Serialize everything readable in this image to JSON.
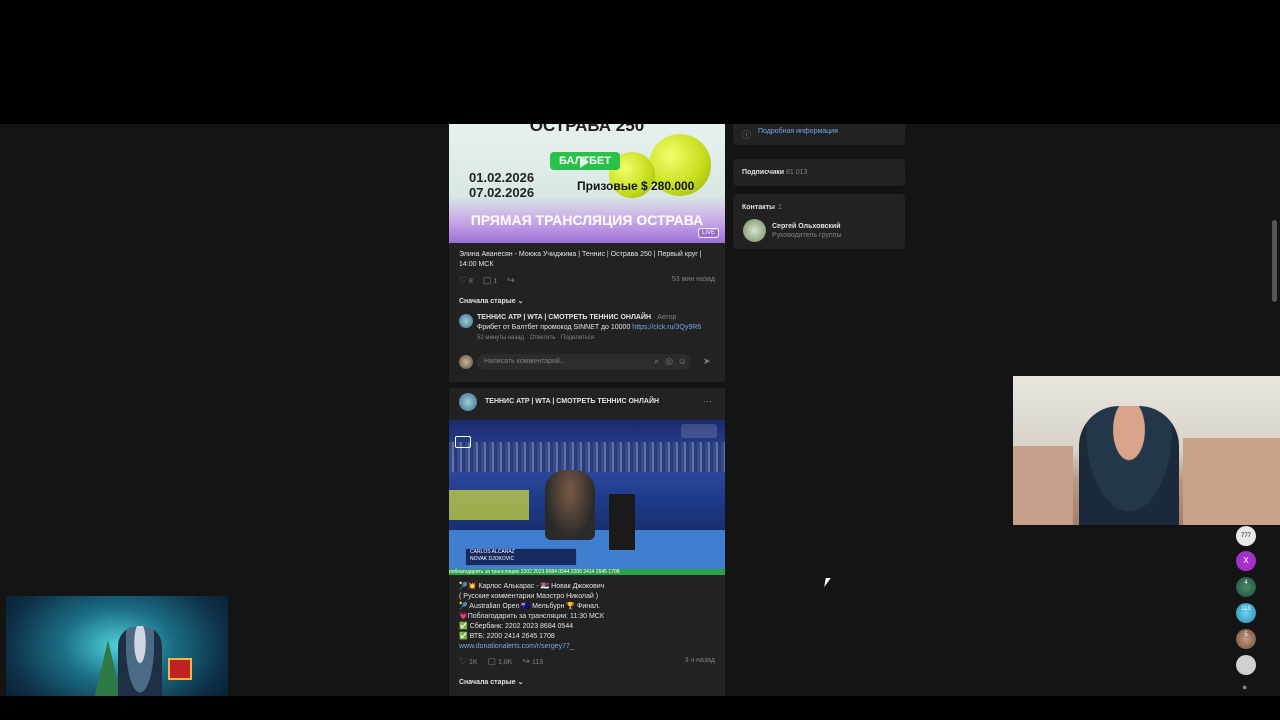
{
  "post1": {
    "banner": {
      "title": "ОСТРАВА 250",
      "sponsor": "БАЛТБЕТ",
      "date1": "01.02.2026",
      "date2": "07.02.2026",
      "prize": "Призовые $ 280.000",
      "live_title": "ПРЯМАЯ ТРАНСЛЯЦИЯ ОСТРАВА",
      "live_badge": "LIVE"
    },
    "text": "Элина Аванесян - Моюка Учиджима | Теннис | Острава 250 | Первый круг | 14:00 МСК",
    "likes": "8",
    "comments": "1",
    "time": "53 мин назад",
    "sort_label": "Сначала старые",
    "comment": {
      "author": "ТЕННИС ATP | WTA | СМОТРЕТЬ ТЕННИС ОНЛАЙН",
      "author_badge": "· Автор",
      "text": "Фрибет от Балтбет промокод SINNET до 10000",
      "link": "https://clck.ru/3Qy9R6",
      "time": "52 минуты назад",
      "reply": "Ответить",
      "share": "Поделиться"
    },
    "comment_placeholder": "Написать комментарий..."
  },
  "post2": {
    "author": "ТЕННИС ATP | WTA | СМОТРЕТЬ ТЕННИС ОНЛАЙН",
    "video": {
      "player1": "CARLOS ALCARAZ",
      "player2": "NOVAK DJOKOVIC",
      "bottom_strip": "поблагодарить за трансляцию   2202 2023 8684 0544   2200 2414 2645 1708"
    },
    "lines": [
      "🎾💥 Карлос Алькарас - 🇷🇸 Новак Джокович",
      "( Русские комментарии Маэстро Николай )",
      "🎾 Australian Open 🇦🇺 Мельбурн 🏆 Финал.",
      "💗Поблагодарить за трансляции: 11:30 МСК",
      "✅ Сбербанк: 2202 2023 8684 0544",
      "✅ ВТБ: 2200 2414 2645 1708"
    ],
    "link": "www.donationalerts.com/r/sergey77_",
    "likes": "1K",
    "comments": "1,8K",
    "shares": "113",
    "time": "3 ч назад",
    "sort_label": "Сначала старые"
  },
  "sidebar": {
    "info_link": "Подробная информация",
    "subscribers_label": "Подписчики",
    "subscribers_count": "81 013",
    "contacts_label": "Контакты",
    "contacts_count": "1",
    "contact_name": "Сергей Ольховский",
    "contact_role": "Руководитель группы"
  },
  "rail": {
    "badges": [
      "777",
      "X",
      "4",
      "113",
      "5"
    ]
  },
  "colors": {
    "page_bg": "#141414",
    "card_bg": "#222222",
    "link": "#71aaeb",
    "muted": "#828282"
  }
}
